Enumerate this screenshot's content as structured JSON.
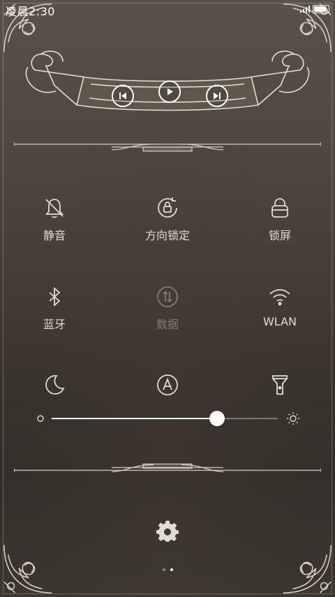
{
  "status_bar": {
    "time": "凌晨2:30"
  },
  "media": {
    "prev_icon": "skip-previous-icon",
    "play_icon": "play-icon",
    "next_icon": "skip-next-icon"
  },
  "toggles": [
    {
      "id": "mute",
      "label": "静音",
      "icon": "bell-off-icon",
      "enabled": true
    },
    {
      "id": "rotation",
      "label": "方向锁定",
      "icon": "rotation-lock-icon",
      "enabled": true
    },
    {
      "id": "lock",
      "label": "锁屏",
      "icon": "lock-icon",
      "enabled": true
    },
    {
      "id": "bluetooth",
      "label": "蓝牙",
      "icon": "bluetooth-icon",
      "enabled": true
    },
    {
      "id": "data",
      "label": "数据",
      "icon": "data-arrows-icon",
      "enabled": false
    },
    {
      "id": "wlan",
      "label": "WLAN",
      "icon": "wifi-icon",
      "enabled": true
    },
    {
      "id": "night",
      "label": "",
      "icon": "moon-icon",
      "enabled": true
    },
    {
      "id": "auto_brightness",
      "label": "",
      "icon": "auto-brightness-icon",
      "enabled": true
    },
    {
      "id": "flashlight",
      "label": "",
      "icon": "flashlight-icon",
      "enabled": true
    }
  ],
  "brightness": {
    "value": 0.73,
    "min_icon": "brightness-low-icon",
    "max_icon": "brightness-high-icon"
  },
  "settings": {
    "icon": "gear-icon"
  },
  "pager": {
    "count": 2,
    "active": 1
  },
  "colors": {
    "accent": "#ffffff",
    "text": "#e0dbd3",
    "background": "#4a423a"
  }
}
